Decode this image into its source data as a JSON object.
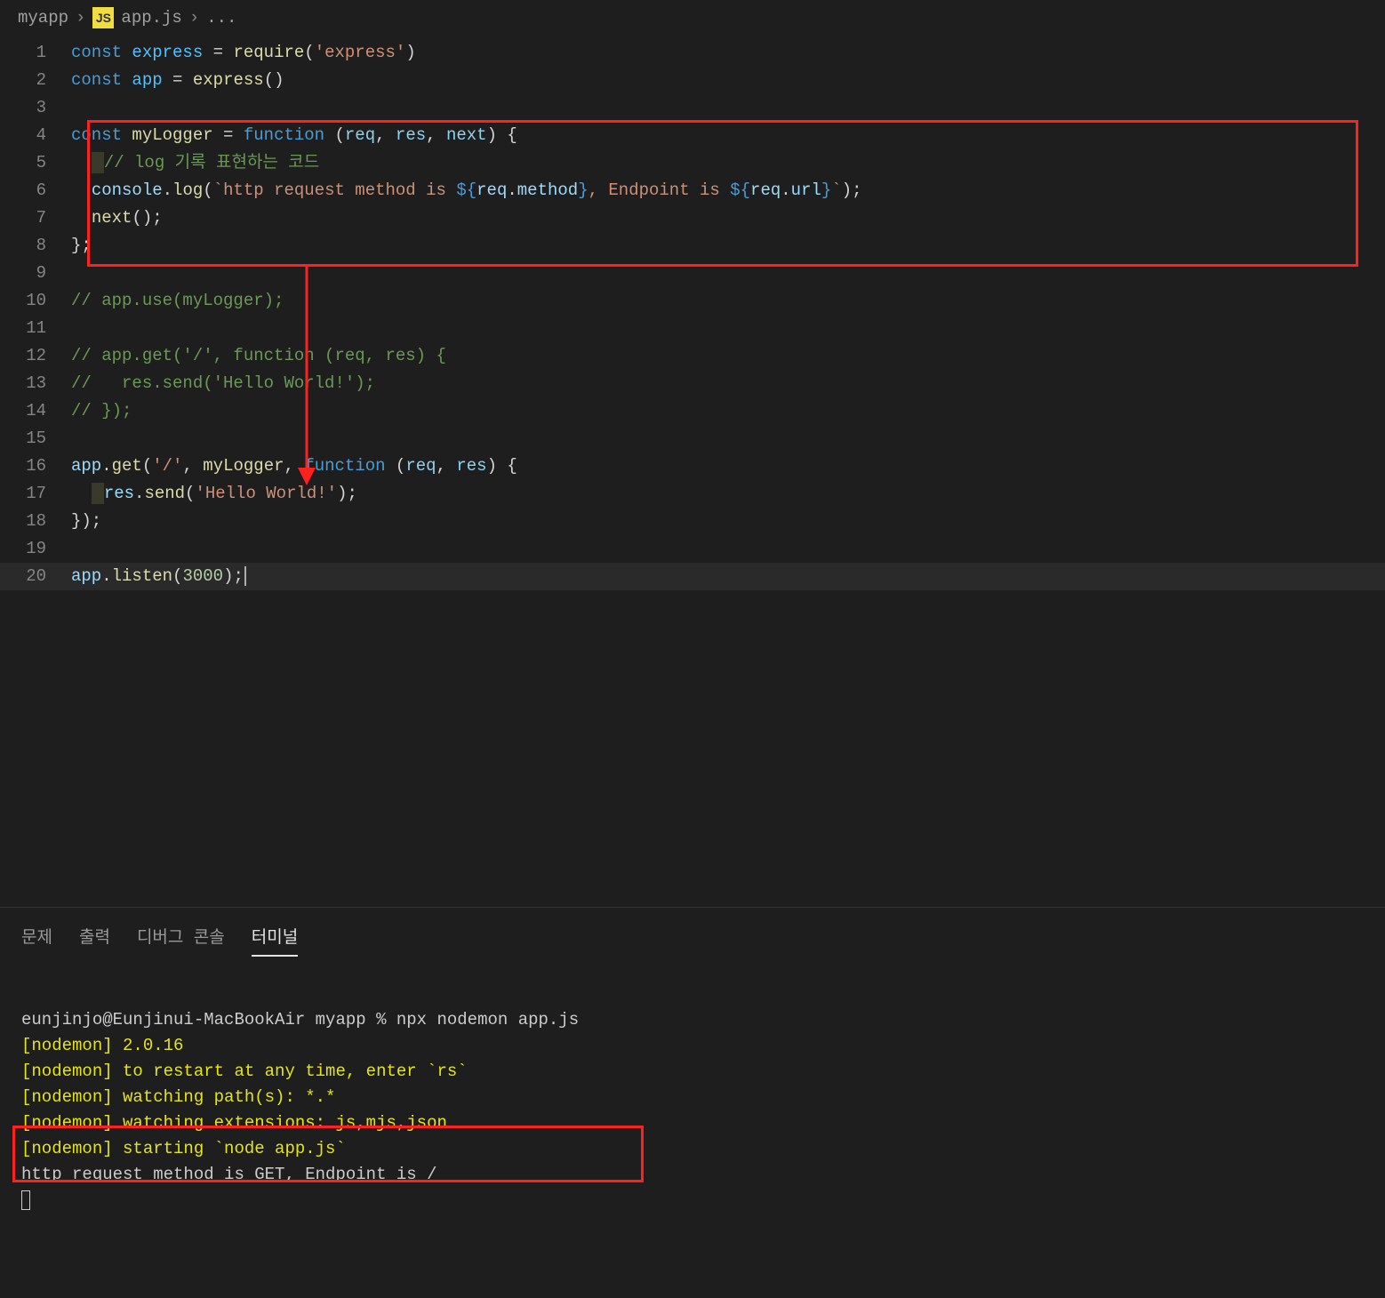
{
  "breadcrumb": {
    "root": "myapp",
    "file": "app.js",
    "more": "...",
    "jsIcon": "JS"
  },
  "code": {
    "l1": {
      "kw": "const",
      "v": "express",
      "eq": " = ",
      "fn": "require",
      "op1": "(",
      "str": "'express'",
      "op2": ")"
    },
    "l2": {
      "kw": "const",
      "v": "app",
      "eq": " = ",
      "fn": "express",
      "par": "()"
    },
    "l4": {
      "kw": "const",
      "v": "myLogger",
      "eq": " = ",
      "fnk": "function",
      "sp1": " (",
      "p1": "req",
      "c": ", ",
      "p2": "res",
      "c2": ", ",
      "p3": "next",
      "close": ") {"
    },
    "l5": {
      "cm": "// log 기록 표현하는 코드"
    },
    "l6": {
      "obj": "console",
      "dot": ".",
      "fn": "log",
      "op": "(",
      "tick": "`",
      "s1": "http request method is ",
      "di1": "${",
      "r1": "req",
      "dp1": ".",
      "m1": "method",
      "de1": "}",
      "s2": ", Endpoint is ",
      "di2": "${",
      "r2": "req",
      "dp2": ".",
      "m2": "url",
      "de2": "}",
      "tick2": "`",
      "cp": ");"
    },
    "l7": {
      "fn": "next",
      "par": "();"
    },
    "l8": {
      "close": "};"
    },
    "l10": {
      "cm": "// app.use(myLogger);"
    },
    "l12": {
      "cm": "// app.get('/', function (req, res) {"
    },
    "l13": {
      "cm": "//   res.send('Hello World!');"
    },
    "l14": {
      "cm": "// });"
    },
    "l16": {
      "obj": "app",
      "dot": ".",
      "fn": "get",
      "op": "(",
      "str": "'/'",
      "c": ", ",
      "mw": "myLogger",
      "c2": ", ",
      "fnk": "function",
      "sp": " (",
      "p1": "req",
      "cc": ", ",
      "p2": "res",
      "close": ") {"
    },
    "l17": {
      "obj": "res",
      "dot": ".",
      "fn": "send",
      "op": "(",
      "str": "'Hello World!'",
      "cp": ");"
    },
    "l18": {
      "close": "});"
    },
    "l20": {
      "obj": "app",
      "dot": ".",
      "fn": "listen",
      "op": "(",
      "num": "3000",
      "cp": ");"
    }
  },
  "lineNumbers": [
    "1",
    "2",
    "3",
    "4",
    "5",
    "6",
    "7",
    "8",
    "9",
    "10",
    "11",
    "12",
    "13",
    "14",
    "15",
    "16",
    "17",
    "18",
    "19",
    "20"
  ],
  "panel": {
    "tabs": {
      "problems": "문제",
      "output": "출력",
      "debug": "디버그 콘솔",
      "terminal": "터미널"
    }
  },
  "terminal": {
    "prompt": "eunjinjo@Eunjinui-MacBookAir myapp % npx nodemon app.js",
    "l1": "[nodemon] 2.0.16",
    "l2": "[nodemon] to restart at any time, enter `rs`",
    "l3": "[nodemon] watching path(s): *.*",
    "l4": "[nodemon] watching extensions: js,mjs,json",
    "l5": "[nodemon] starting `node app.js`",
    "out": "http request method is GET, Endpoint is /"
  }
}
